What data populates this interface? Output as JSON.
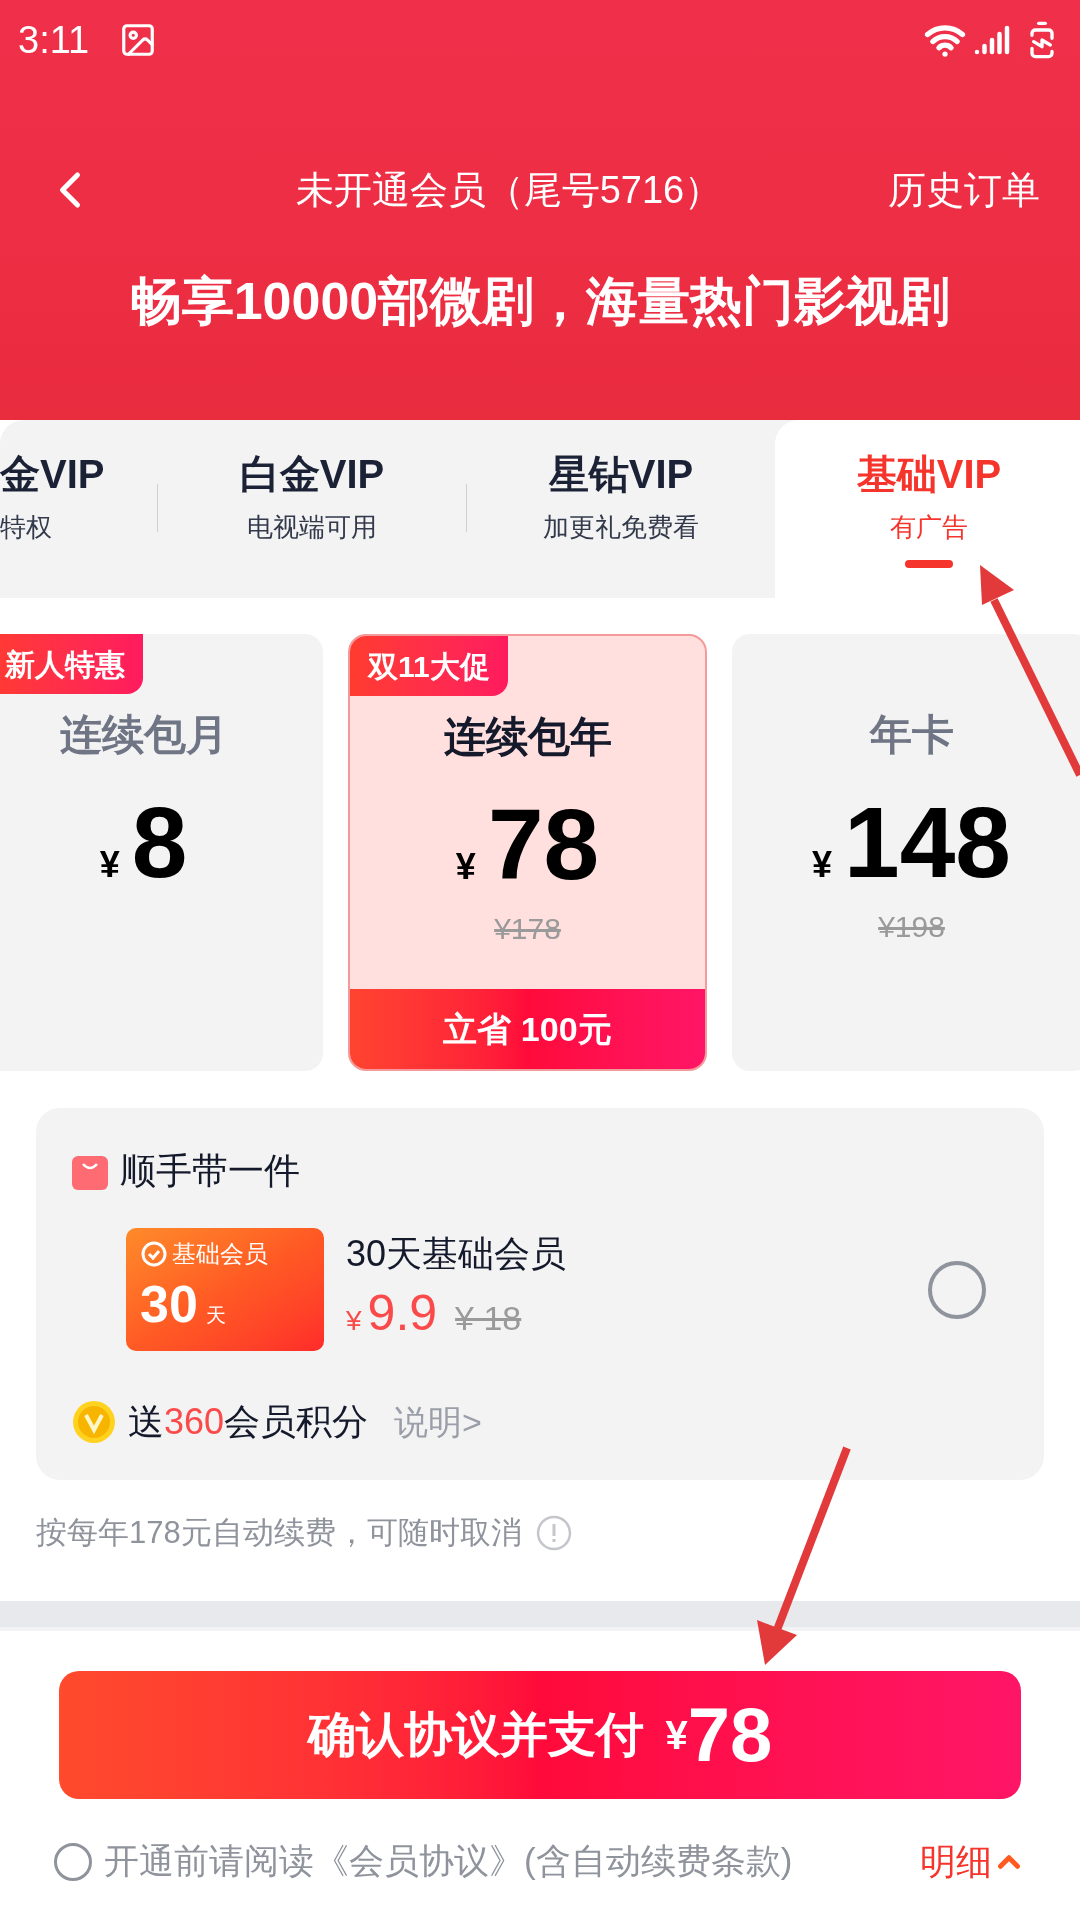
{
  "status_bar": {
    "time": "3:11"
  },
  "nav": {
    "title": "未开通会员（尾号5716）",
    "action": "历史订单"
  },
  "slogan": "畅享10000部微剧，海量热门影视剧",
  "tabs": [
    {
      "label": "金VIP",
      "sub": "特权",
      "selected": false
    },
    {
      "label": "白金VIP",
      "sub": "电视端可用",
      "selected": false
    },
    {
      "label": "星钻VIP",
      "sub": "加更礼免费看",
      "selected": false
    },
    {
      "label": "基础VIP",
      "sub": "有广告",
      "selected": true
    }
  ],
  "plans": [
    {
      "badge": "新人特惠",
      "name": "连续包月",
      "currency": "¥",
      "price": "8",
      "selected": false
    },
    {
      "badge": "双11大促",
      "name": "连续包年",
      "currency": "¥",
      "price": "78",
      "original": "¥178",
      "saving": "立省 100元",
      "selected": true
    },
    {
      "name": "年卡",
      "currency": "¥",
      "price": "148",
      "original": "¥198",
      "selected": false
    }
  ],
  "addon": {
    "title": "顺手带一件",
    "card_label": "基础会员",
    "card_days": "30",
    "card_unit": "天",
    "name": "30天基础会员",
    "currency": "¥",
    "price": "9.9",
    "original": "¥ 18",
    "checked": false,
    "points": "送**360**会员积分",
    "explain": "说明>"
  },
  "renewal_note": "按每年178元自动续费，可随时取消",
  "pay_button": {
    "label": "确认协议并支付",
    "currency": "¥",
    "amount": "78"
  },
  "agreement": {
    "text": "开通前请阅读《会员协议》(含自动续费条款)",
    "checked": false,
    "details": "明细"
  }
}
